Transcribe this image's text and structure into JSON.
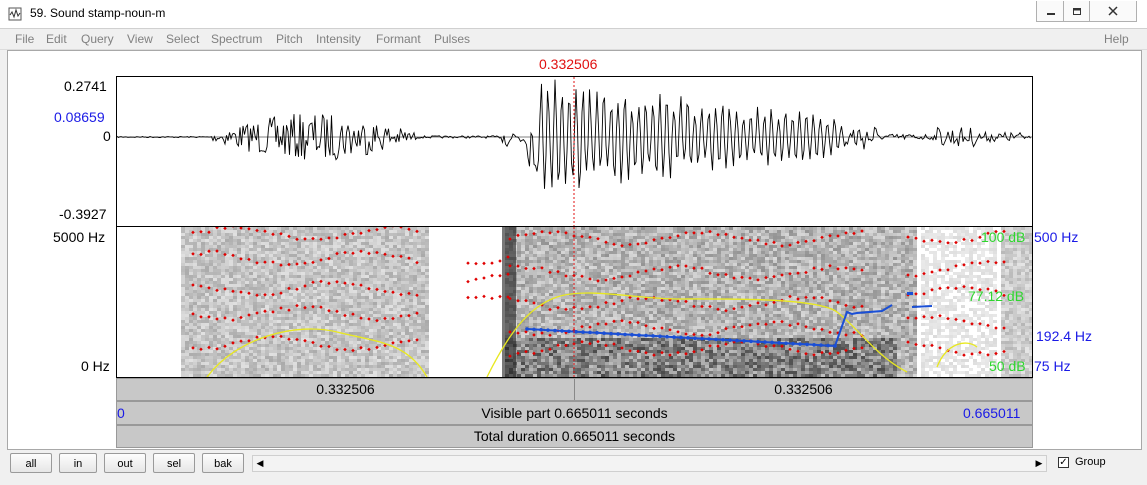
{
  "window": {
    "title": "59. Sound stamp-noun-m",
    "buttons": [
      "minimize",
      "maximize",
      "close"
    ]
  },
  "menu": {
    "items": [
      "File",
      "Edit",
      "Query",
      "View",
      "Select",
      "Spectrum",
      "Pitch",
      "Intensity",
      "Formant",
      "Pulses"
    ],
    "help": "Help"
  },
  "waveform": {
    "cursor_time": "0.332506",
    "y_max": "0.2741",
    "y_cursor": "0.08659",
    "y_zero": "0",
    "y_min": "-0.3927"
  },
  "spectrogram": {
    "freq_top": "5000 Hz",
    "freq_bottom": "0 Hz",
    "intensity_top": "100 dB",
    "intensity_cursor": "77.12 dB",
    "intensity_bottom": "50 dB",
    "pitch_top": "500 Hz",
    "pitch_cursor": "192.4 Hz",
    "pitch_bottom": "75 Hz"
  },
  "time_bars": {
    "left_half": "0.332506",
    "right_half": "0.332506",
    "visible_start": "0",
    "visible_text": "Visible part 0.665011 seconds",
    "visible_end": "0.665011",
    "total_text": "Total duration 0.665011 seconds"
  },
  "bottom": {
    "buttons": [
      "all",
      "in",
      "out",
      "sel",
      "bak"
    ],
    "group_label": "Group",
    "group_checked": true
  },
  "colors": {
    "cursor": "#e01010",
    "pitch": "#1a4fd6",
    "formant": "#e00000",
    "intensity": "#e8e820",
    "axis_blue": "#1a1ae6",
    "axis_green": "#2ed62e"
  }
}
